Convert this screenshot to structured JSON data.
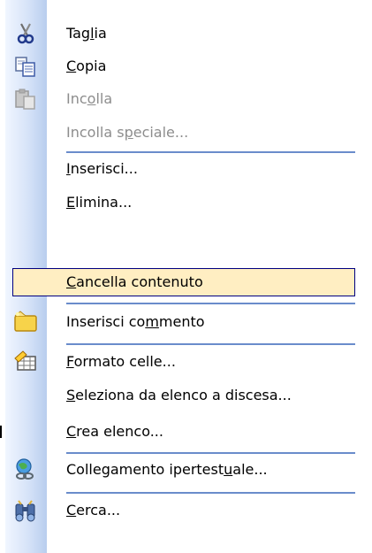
{
  "menu": {
    "items": [
      {
        "pre": "Tag",
        "u": "l",
        "post": "ia",
        "icon": "scissors-icon"
      },
      {
        "pre": "",
        "u": "C",
        "post": "opia",
        "icon": "copy-icon"
      },
      {
        "pre": "Inc",
        "u": "o",
        "post": "lla",
        "icon": "paste-icon",
        "disabled": true
      },
      {
        "pre": "Incolla s",
        "u": "p",
        "post": "eciale...",
        "disabled": true
      },
      {
        "pre": "",
        "u": "I",
        "post": "nserisci..."
      },
      {
        "pre": "",
        "u": "E",
        "post": "limina..."
      },
      {
        "pre": "",
        "u": "C",
        "post": "ancella contenuto",
        "highlighted": true
      },
      {
        "pre": "Inserisci co",
        "u": "m",
        "post": "mento",
        "icon": "comment-icon"
      },
      {
        "pre": "",
        "u": "F",
        "post": "ormato celle...",
        "icon": "format-cells-icon"
      },
      {
        "pre": "",
        "u": "S",
        "post": "eleziona da elenco a discesa..."
      },
      {
        "pre": "",
        "u": "C",
        "post": "rea elenco..."
      },
      {
        "pre": "Collegamento ipertest",
        "u": "u",
        "post": "ale...",
        "icon": "hyperlink-icon"
      },
      {
        "pre": "",
        "u": "C",
        "post": "erca...",
        "icon": "search-icon"
      }
    ]
  }
}
